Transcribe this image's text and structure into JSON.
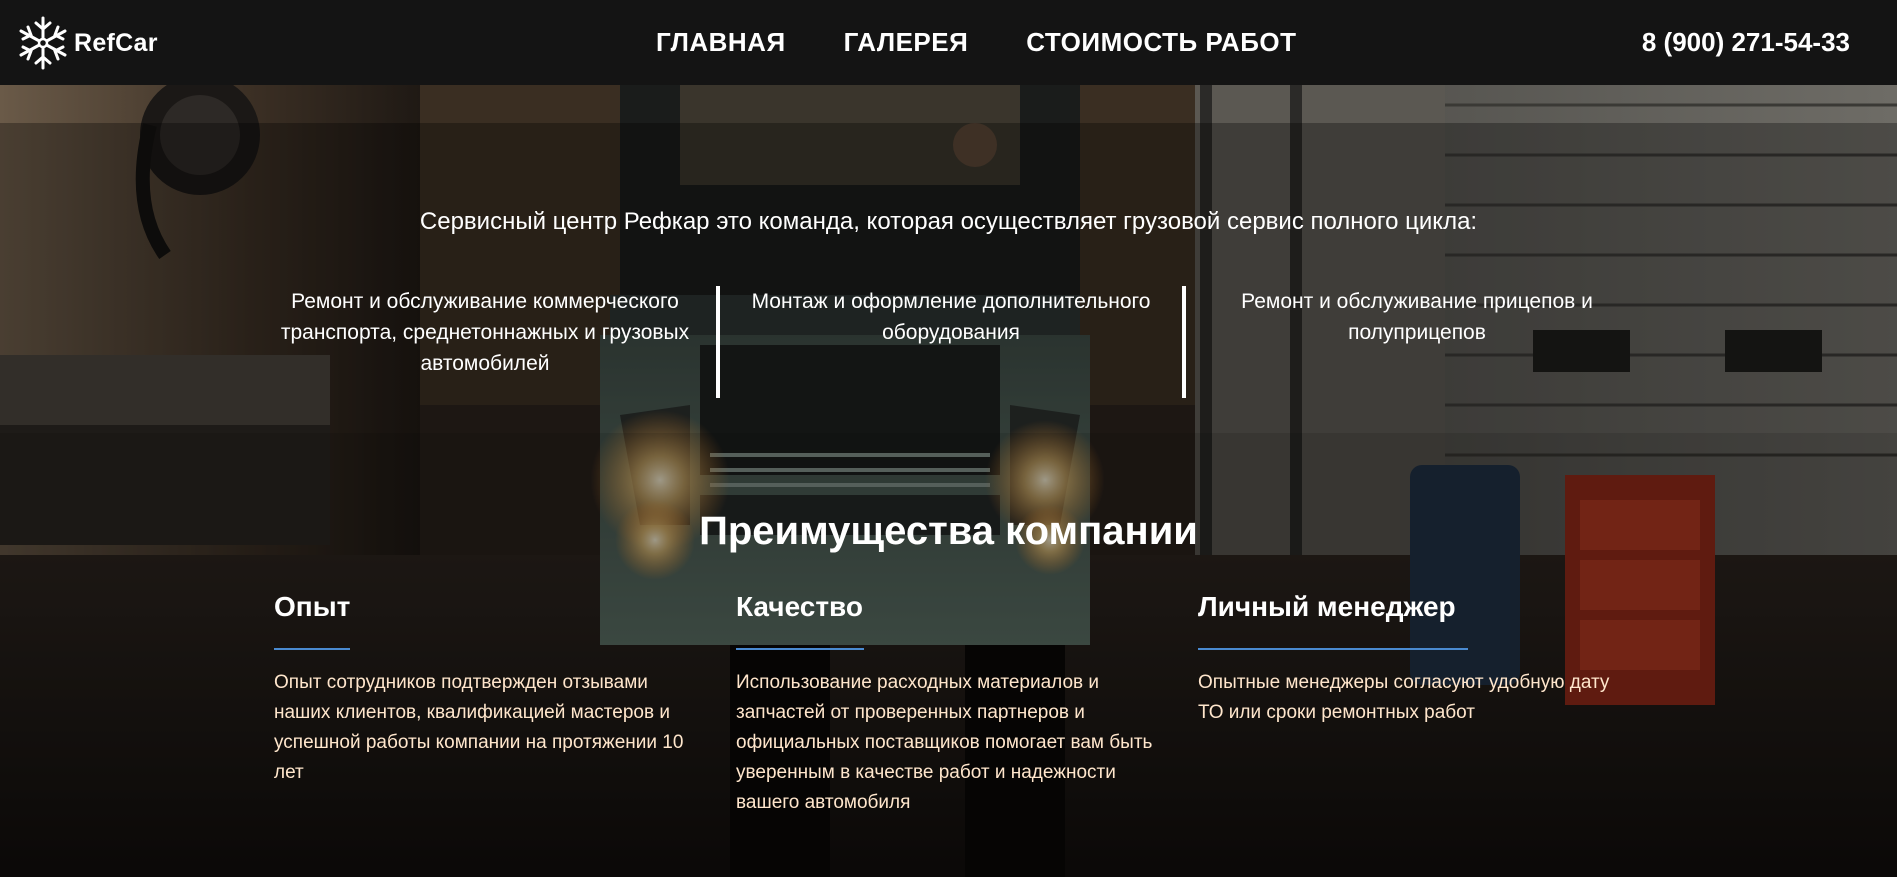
{
  "header": {
    "logo_text": "RefCar",
    "nav": [
      "ГЛАВНАЯ",
      "ГАЛЕРЕЯ",
      "СТОИМОСТЬ РАБОТ"
    ],
    "phone": "8 (900) 271-54-33"
  },
  "intro": {
    "text": "Сервисный центр Рефкар это команда, которая осуществляет грузовой сервис полного цикла:",
    "services": [
      "Ремонт и обслуживание коммерческого транспорта, среднетоннажных и грузовых автомобилей",
      "Монтаж и оформление дополнительного оборудования",
      "Ремонт и обслуживание прицепов и полуприцепов"
    ]
  },
  "advantages": {
    "title": "Преимущества компании",
    "items": [
      {
        "title": "Опыт",
        "text": "Опыт сотрудников подтвержден отзывами наших клиентов, квалификацией мастеров и успешной работы компании на протяжении 10 лет"
      },
      {
        "title": "Качество",
        "text": "Использование расходных материалов и запчастей от проверенных партнеров и официальных поставщиков помогает вам быть уверенным в качестве работ и надежности вашего автомобиля"
      },
      {
        "title": "Личный менеджер",
        "text": "Опытные менеджеры согласуют удобную дату ТО или сроки ремонтных работ"
      }
    ]
  },
  "colors": {
    "header_bg": "#141414",
    "accent_line": "#4a8ad0",
    "advantage_text": "#ffe6cc"
  },
  "icons": {
    "logo": "snowflake-icon"
  }
}
